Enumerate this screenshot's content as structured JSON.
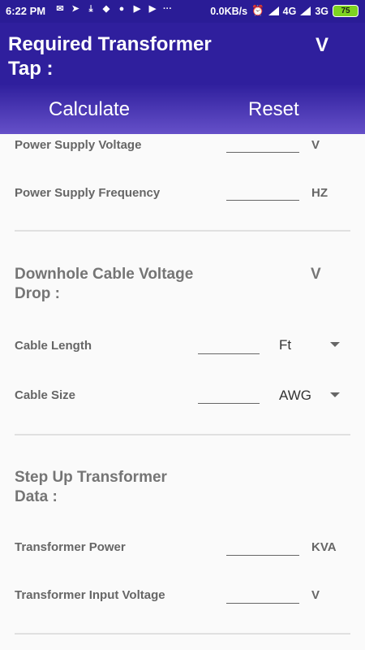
{
  "status_bar": {
    "time": "6:22 PM",
    "dots": "···",
    "speed": "0.0KB/s",
    "network1": "4G",
    "network2": "3G",
    "battery": "75",
    "icons": [
      "mail-icon",
      "telegram-icon",
      "download-icon",
      "app-icon",
      "chat-icon",
      "youtube-icon",
      "youtube-icon",
      "alarm-icon",
      "signal-icon",
      "signal-icon"
    ]
  },
  "header": {
    "title": "Required Transformer Tap :",
    "unit": "V",
    "calculate_label": "Calculate",
    "reset_label": "Reset",
    "background": "#2f1f9d"
  },
  "power_supply": {
    "voltage_label": "Power Supply Voltage",
    "voltage_value": "",
    "voltage_unit": "V",
    "frequency_label": "Power Supply Frequency",
    "frequency_value": "",
    "frequency_unit": "HZ"
  },
  "cable_drop": {
    "heading": "Downhole Cable Voltage Drop :",
    "unit": "V",
    "length_label": "Cable Length",
    "length_value": "",
    "length_unit": "Ft",
    "size_label": "Cable Size",
    "size_value": "",
    "size_unit": "AWG"
  },
  "step_up": {
    "heading": "Step Up Transformer Data :",
    "power_label": "Transformer Power",
    "power_value": "",
    "power_unit": "KVA",
    "input_voltage_label": "Transformer Input Voltage",
    "input_voltage_value": "",
    "input_voltage_unit": "V"
  }
}
